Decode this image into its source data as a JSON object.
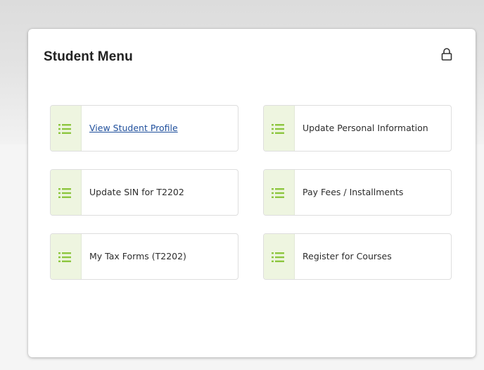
{
  "card": {
    "title": "Student Menu",
    "lock_icon": "lock-icon"
  },
  "colors": {
    "icon_green": "#8dc63f",
    "icon_column_bg": "#eef5e0",
    "link": "#1f4f9c"
  },
  "menu": {
    "items": [
      {
        "label": "View Student Profile",
        "icon": "list-icon",
        "is_link": true
      },
      {
        "label": "Update Personal Information",
        "icon": "list-icon",
        "is_link": false
      },
      {
        "label": "Update SIN for T2202",
        "icon": "list-icon",
        "is_link": false
      },
      {
        "label": "Pay Fees / Installments",
        "icon": "list-icon",
        "is_link": false
      },
      {
        "label": "My Tax Forms (T2202)",
        "icon": "list-icon",
        "is_link": false
      },
      {
        "label": "Register for Courses",
        "icon": "list-icon",
        "is_link": false
      }
    ]
  }
}
